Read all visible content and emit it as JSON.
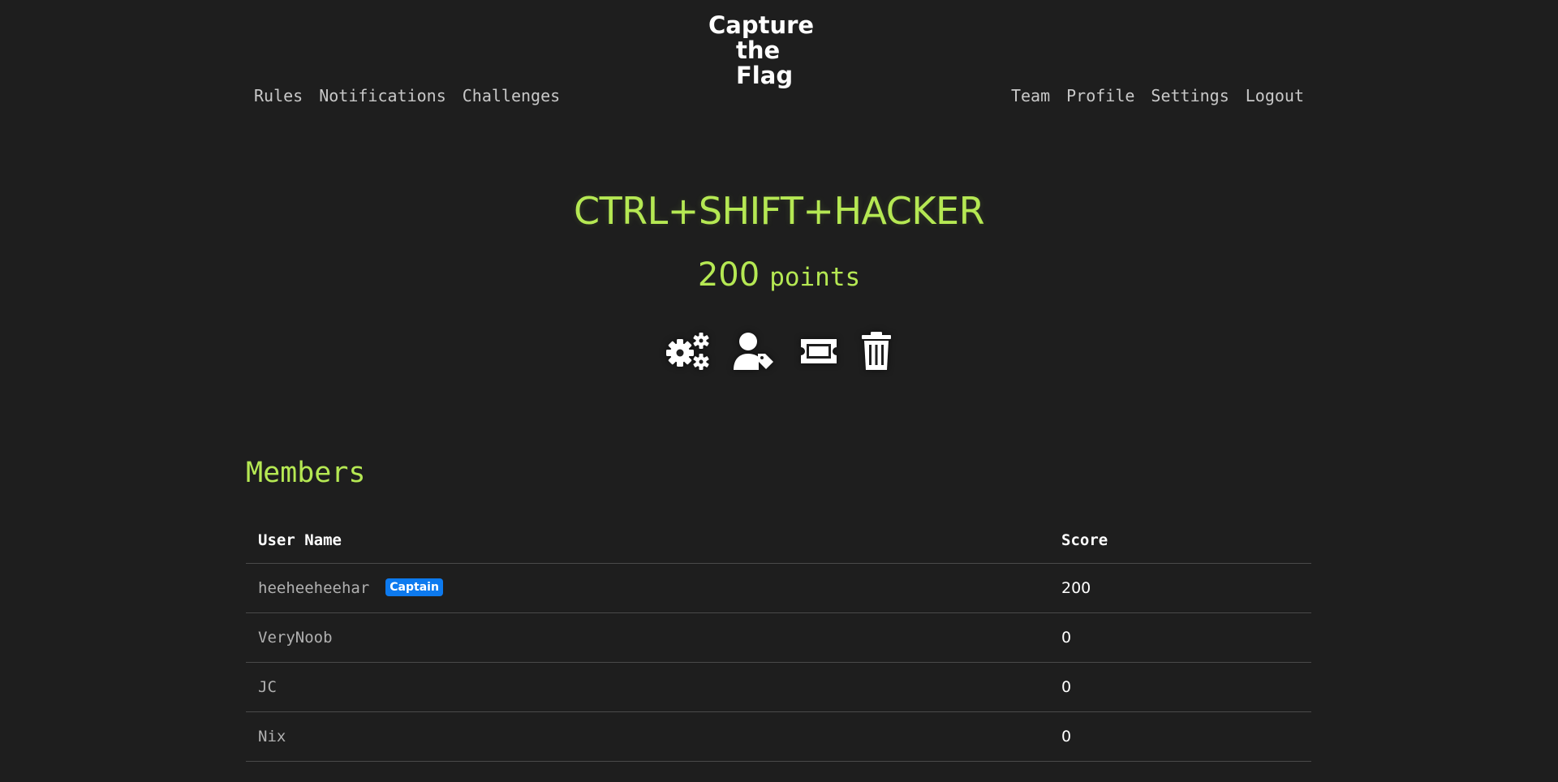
{
  "logo": {
    "line1": "Capture",
    "line2": "the Flag"
  },
  "nav": {
    "left": [
      "Rules",
      "Notifications",
      "Challenges"
    ],
    "right": [
      "Team",
      "Profile",
      "Settings",
      "Logout"
    ]
  },
  "team": {
    "name": "CTRL+SHIFT+HACKER",
    "points_value": "200",
    "points_label": "points",
    "actions": [
      {
        "icon": "cogs-icon"
      },
      {
        "icon": "user-tag-icon"
      },
      {
        "icon": "ticket-icon"
      },
      {
        "icon": "trash-icon"
      }
    ]
  },
  "members": {
    "title": "Members",
    "headers": {
      "name": "User Name",
      "score": "Score"
    },
    "rows": [
      {
        "name": "heeheeheehar",
        "badge": "Captain",
        "score": "200"
      },
      {
        "name": "VeryNoob",
        "score": "0"
      },
      {
        "name": "JC",
        "score": "0"
      },
      {
        "name": "Nix",
        "score": "0"
      }
    ]
  },
  "colors": {
    "background": "#1e1e1e",
    "accent": "#b5e853",
    "badge": "#0d7aef",
    "nav_text": "#c8c8c8",
    "divider": "#4a4a4a"
  }
}
